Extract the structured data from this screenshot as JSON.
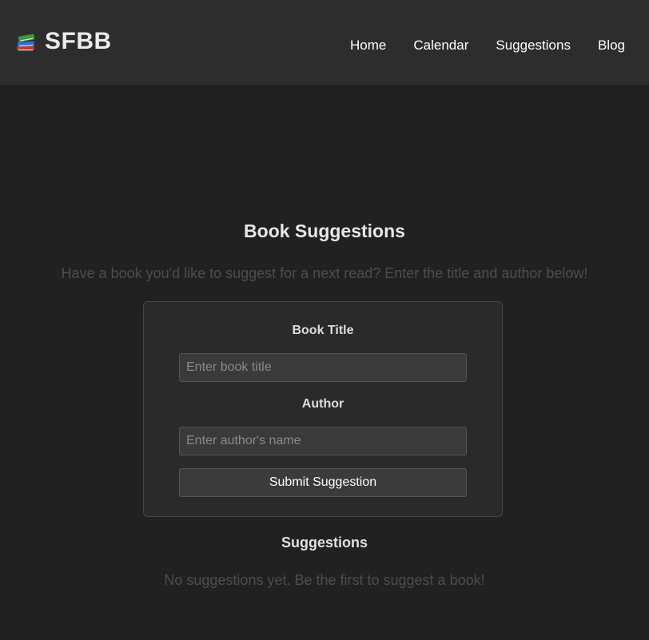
{
  "header": {
    "brand_icon": "books-icon",
    "brand_name": "SFBB",
    "nav": [
      "Home",
      "Calendar",
      "Suggestions",
      "Blog"
    ]
  },
  "main": {
    "title": "Book Suggestions",
    "subtitle": "Have a book you'd like to suggest for a next read? Enter the title and author below!",
    "form": {
      "title_label": "Book Title",
      "title_value": "",
      "title_placeholder": "Enter book title",
      "author_label": "Author",
      "author_value": "",
      "author_placeholder": "Enter author's name",
      "submit_label": "Submit Suggestion"
    },
    "suggestions_heading": "Suggestions",
    "empty_message": "No suggestions yet. Be the first to suggest a book!"
  },
  "colors": {
    "page_background": "#212121",
    "header_background": "#2d2d2d",
    "card_background": "#2a2a2a",
    "muted_text": "#4d4d4d"
  }
}
